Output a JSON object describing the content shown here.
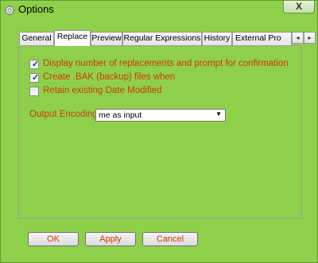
{
  "window": {
    "title": "Options",
    "title_icon": "gear-icon",
    "close_glyph": "X"
  },
  "tabs": [
    {
      "label": "General",
      "active": false
    },
    {
      "label": "Replace",
      "active": true
    },
    {
      "label": "Preview",
      "active": false
    },
    {
      "label": "Regular Expressions",
      "active": false
    },
    {
      "label": "History",
      "active": false
    },
    {
      "label": "External Pro",
      "active": false
    }
  ],
  "tab_scroll": {
    "left": "◂",
    "right": "▸"
  },
  "options": [
    {
      "label": "Display number of replacements and prompt for confirmation",
      "checked": true
    },
    {
      "label": "Create .BAK (backup) files when",
      "checked": true
    },
    {
      "label": "Retain existing Date Modified",
      "checked": false
    }
  ],
  "encoding": {
    "label": "Output Encoding:",
    "value": "me as input"
  },
  "buttons": {
    "ok": "OK",
    "apply": "Apply",
    "cancel": "Cancel"
  },
  "colors": {
    "background": "#8fd04a",
    "label_text": "#cc3a0c"
  }
}
